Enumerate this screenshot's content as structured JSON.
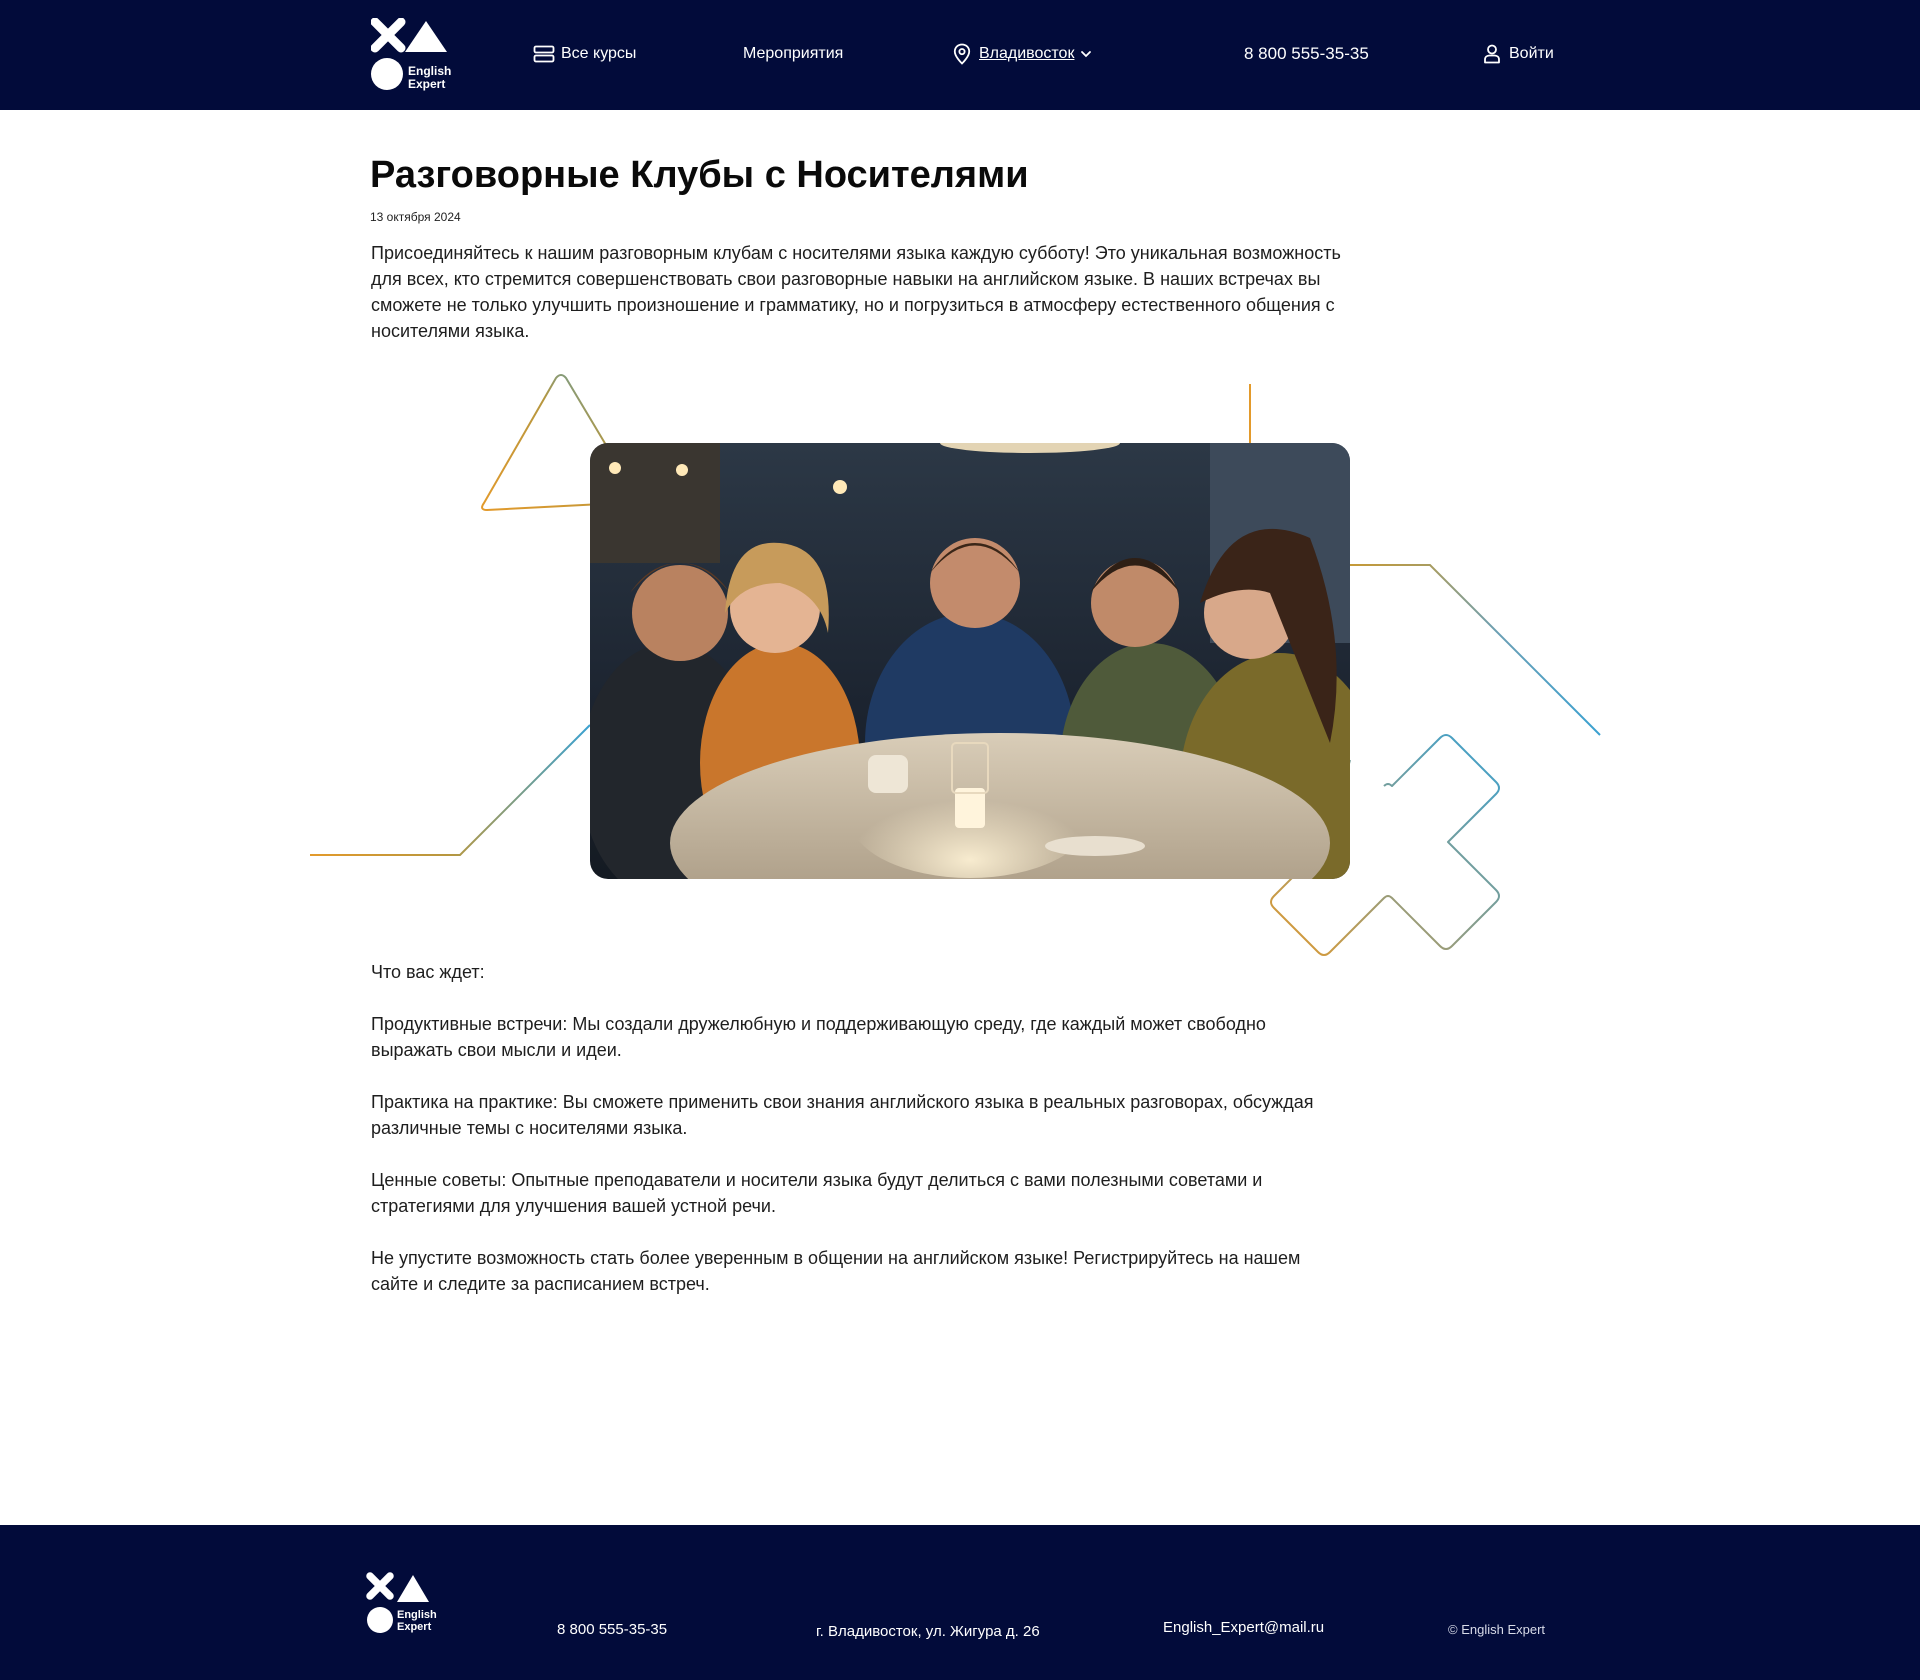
{
  "header": {
    "logo_text_line1": "English",
    "logo_text_line2": "Expert",
    "nav_all_courses": "Все курсы",
    "nav_events": "Мероприятия",
    "nav_city": "Владивосток",
    "phone": "8 800 555-35-35",
    "login": "Войти",
    "icons": [
      "courses-icon",
      "location-pin-icon",
      "chevron-down-icon",
      "user-icon"
    ]
  },
  "article": {
    "title": "Разговорные Клубы с Носителями",
    "date": "13 октября 2024",
    "intro": "Присоединяйтесь к нашим разговорным клубам с носителями языка каждую субботу! Это уникальная возможность для всех, кто стремится совершенствовать свои разговорные навыки на английском языке. В наших встречах вы сможете не только улучшить произношение и грамматику, но и погрузиться в атмосферу естественного общения с носителями языка.",
    "p1": "Что вас ждет:",
    "p2": "Продуктивные встречи: Мы создали дружелюбную и поддерживающую среду, где каждый может свободно выражать свои мысли и идеи.",
    "p3": "Практика на практике: Вы сможете применить свои знания английского языка в реальных разговорах, обсуждая различные темы с носителями языка.",
    "p4": "Ценные советы: Опытные преподаватели и носители языка будут делиться с вами полезными советами и стратегиями для улучшения вашей устной речи.",
    "p5": "Не упустите возможность стать более уверенным в общении на английском языке! Регистрируйтесь на нашем сайте и следите за расписанием встреч."
  },
  "footer": {
    "logo_text_line1": "English",
    "logo_text_line2": "Expert",
    "phone": "8 800 555-35-35",
    "address": "г. Владивосток, ул. Жигура д. 26",
    "email": "English_Expert@mail.ru",
    "copyright": "© English Expert"
  },
  "colors": {
    "header_bg": "#020b3a",
    "accent_orange": "#e39a2b",
    "accent_blue": "#3aa1d1"
  }
}
